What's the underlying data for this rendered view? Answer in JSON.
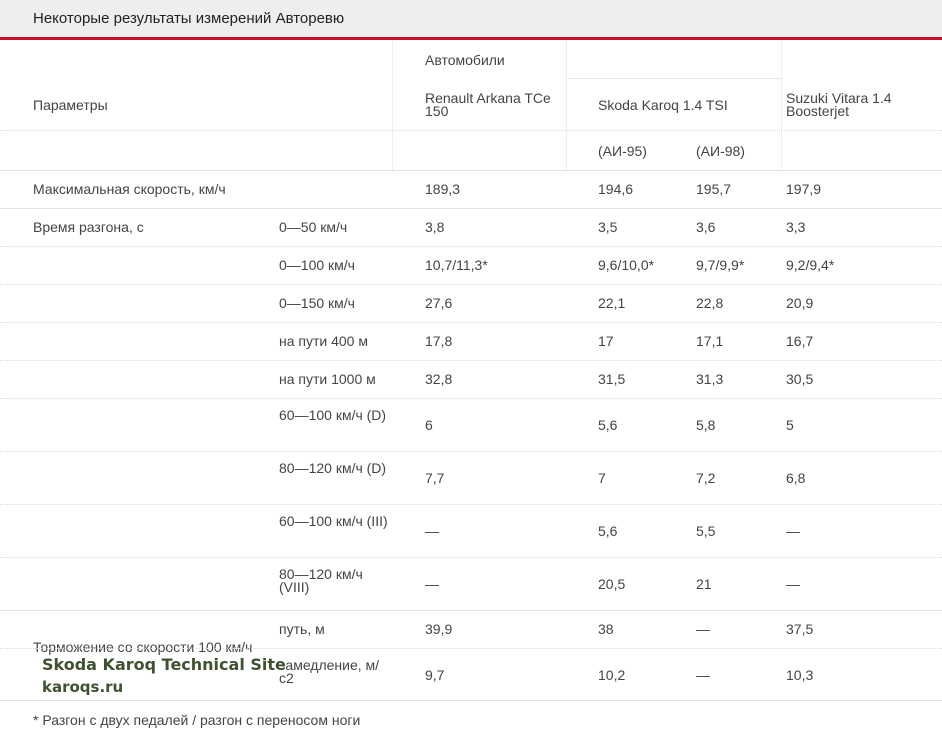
{
  "header": {
    "title": "Некоторые результаты измерений Авторевю"
  },
  "table": {
    "cars_label": "Автомобили",
    "params_label": "Параметры",
    "cars": [
      "Renault Arkana TCe 150",
      "Skoda Karoq 1.4 TSI",
      "Suzuki Vitara 1.4 Boosterjet"
    ],
    "fuel": [
      "(АИ-95)",
      "(АИ-98)"
    ],
    "rows": [
      {
        "param": "Максимальная скорость, км/ч",
        "sub": "",
        "vals": [
          "189,3",
          "194,6",
          "195,7",
          "197,9"
        ]
      },
      {
        "param": "Время разгона, с",
        "sub": "0—50 км/ч",
        "vals": [
          "3,8",
          "3,5",
          "3,6",
          "3,3"
        ]
      },
      {
        "param": "",
        "sub": "0—100 км/ч",
        "vals": [
          "10,7/11,3*",
          "9,6/10,0*",
          "9,7/9,9*",
          "9,2/9,4*"
        ]
      },
      {
        "param": "",
        "sub": "0—150 км/ч",
        "vals": [
          "27,6",
          "22,1",
          "22,8",
          "20,9"
        ]
      },
      {
        "param": "",
        "sub": "на пути 400 м",
        "vals": [
          "17,8",
          "17",
          "17,1",
          "16,7"
        ]
      },
      {
        "param": "",
        "sub": "на пути 1000 м",
        "vals": [
          "32,8",
          "31,5",
          "31,3",
          "30,5"
        ]
      },
      {
        "param": "",
        "sub": "60—100 км/ч (D)",
        "vals": [
          "6",
          "5,6",
          "5,8",
          "5"
        ]
      },
      {
        "param": "",
        "sub": "80—120 км/ч (D)",
        "vals": [
          "7,7",
          "7",
          "7,2",
          "6,8"
        ]
      },
      {
        "param": "",
        "sub": "60—100 км/ч (III)",
        "vals": [
          "—",
          "5,6",
          "5,5",
          "—"
        ]
      },
      {
        "param": "",
        "sub": "80—120 км/ч (VIII)",
        "vals": [
          "—",
          "20,5",
          "21",
          "—"
        ]
      },
      {
        "param": "Торможение со скорости 100 км/ч",
        "sub": "путь, м",
        "vals": [
          "39,9",
          "38",
          "—",
          "37,5"
        ]
      },
      {
        "param": "",
        "sub": "замедление, м/с2",
        "vals": [
          "9,7",
          "10,2",
          "—",
          "10,3"
        ]
      }
    ]
  },
  "footnote": "* Разгон с двух педалей / разгон с переносом ноги",
  "watermark": {
    "line1": "Skoda Karoq Technical Site",
    "line2": "karoqs.ru"
  }
}
